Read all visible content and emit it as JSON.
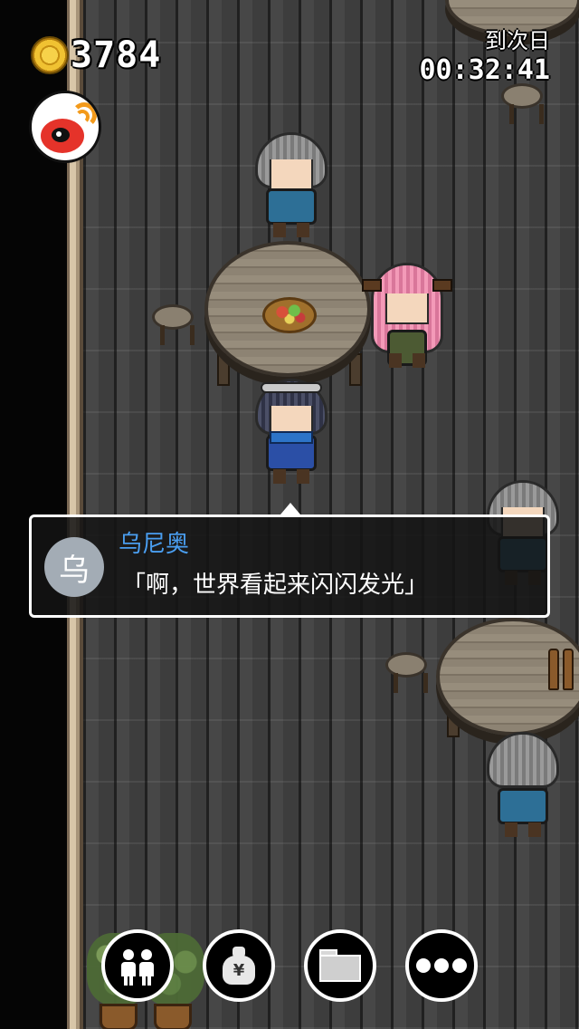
{
  "hud": {
    "coins": "3784",
    "timer_label": "到次日",
    "timer_value": "00:32:41"
  },
  "dialog": {
    "avatar_char": "乌",
    "speaker": "乌尼奥",
    "line": "「啊，世界看起来闪闪发光」"
  },
  "icons": {
    "coin": "gold-coin-icon",
    "share": "weibo-icon",
    "party": "party-members-icon",
    "bag": "money-bag-icon",
    "folder": "folder-icon",
    "more": "more-dots-icon"
  },
  "colors": {
    "speaker_name": "#4a9ef0",
    "dialog_bg": "#141414",
    "weibo_red": "#e5332a",
    "weibo_orange": "#f39a1b"
  }
}
